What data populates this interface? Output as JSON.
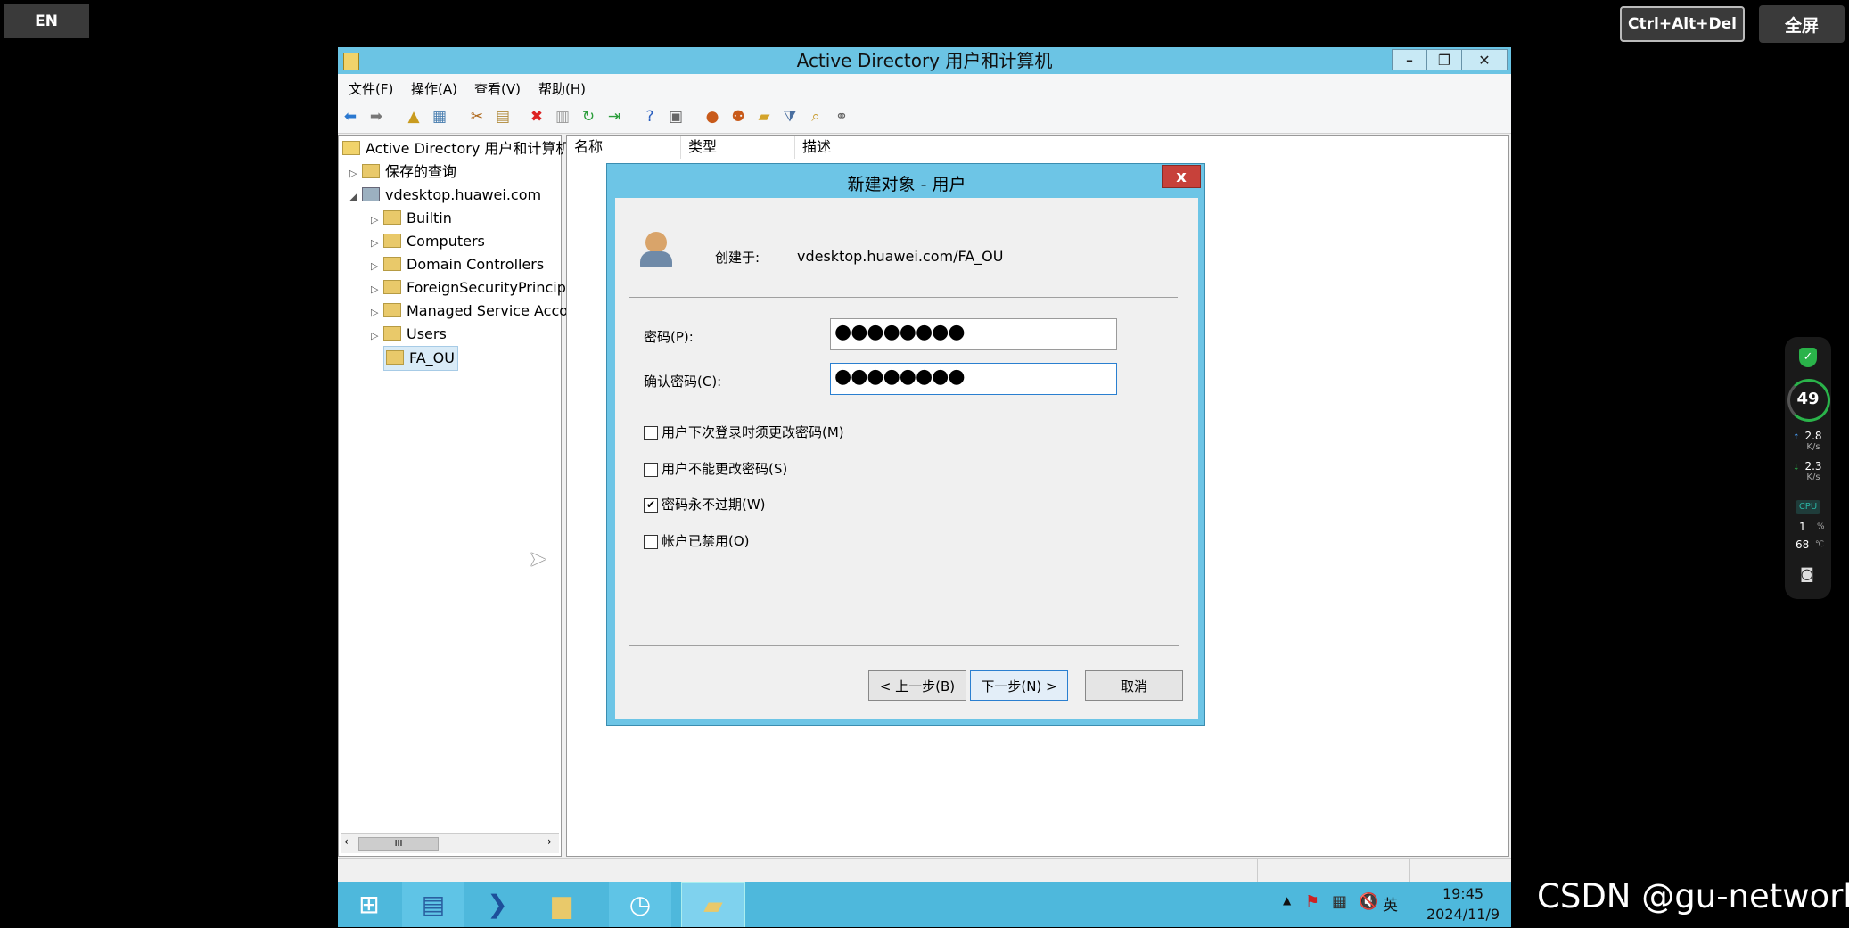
{
  "top_controls": {
    "language": "EN",
    "ctrl_alt_del": "Ctrl+Alt+Del",
    "fullscreen": "全屏"
  },
  "window": {
    "title": "Active Directory 用户和计算机",
    "controls": {
      "minimize": "–",
      "restore": "❐",
      "close": "✕"
    },
    "menu": [
      "文件(F)",
      "操作(A)",
      "查看(V)",
      "帮助(H)"
    ]
  },
  "tree": {
    "root": "Active Directory 用户和计算机",
    "saved_queries": "保存的查询",
    "domain": "vdesktop.huawei.com",
    "items": [
      "Builtin",
      "Computers",
      "Domain Controllers",
      "ForeignSecurityPrincipa",
      "Managed Service Acco",
      "Users",
      "FA_OU"
    ],
    "scroll_thumb": "III"
  },
  "list": {
    "columns": [
      "名称",
      "类型",
      "描述"
    ]
  },
  "dialog": {
    "title": "新建对象 - 用户",
    "close": "x",
    "created_in_label": "创建于:",
    "created_in_value": "vdesktop.huawei.com/FA_OU",
    "password_label": "密码(P):",
    "password_value": "●●●●●●●●",
    "confirm_label": "确认密码(C):",
    "confirm_value": "●●●●●●●●",
    "checkboxes": [
      {
        "label": "用户下次登录时须更改密码(M)",
        "checked": false
      },
      {
        "label": "用户不能更改密码(S)",
        "checked": false
      },
      {
        "label": "密码永不过期(W)",
        "checked": true
      },
      {
        "label": "帐户已禁用(O)",
        "checked": false
      }
    ],
    "back_button": "< 上一步(B)",
    "next_button": "下一步(N) >",
    "cancel_button": "取消"
  },
  "taskbar": {
    "time": "19:45",
    "date": "2024/11/9",
    "ime": "英"
  },
  "monitor_widget": {
    "score": "49",
    "upload": "2.8",
    "upload_unit": "K/s",
    "download": "2.3",
    "download_unit": "K/s",
    "cpu_label": "CPU",
    "cpu_value": "1",
    "cpu_unit": "%",
    "temp_value": "68",
    "temp_unit": "℃"
  },
  "watermark": "CSDN @gu-network",
  "colors": {
    "titlebar": "#6bc4e4",
    "taskbar": "#4eb8dc",
    "dialog_frame": "#6dc5e6",
    "close_red": "#c7413a"
  }
}
